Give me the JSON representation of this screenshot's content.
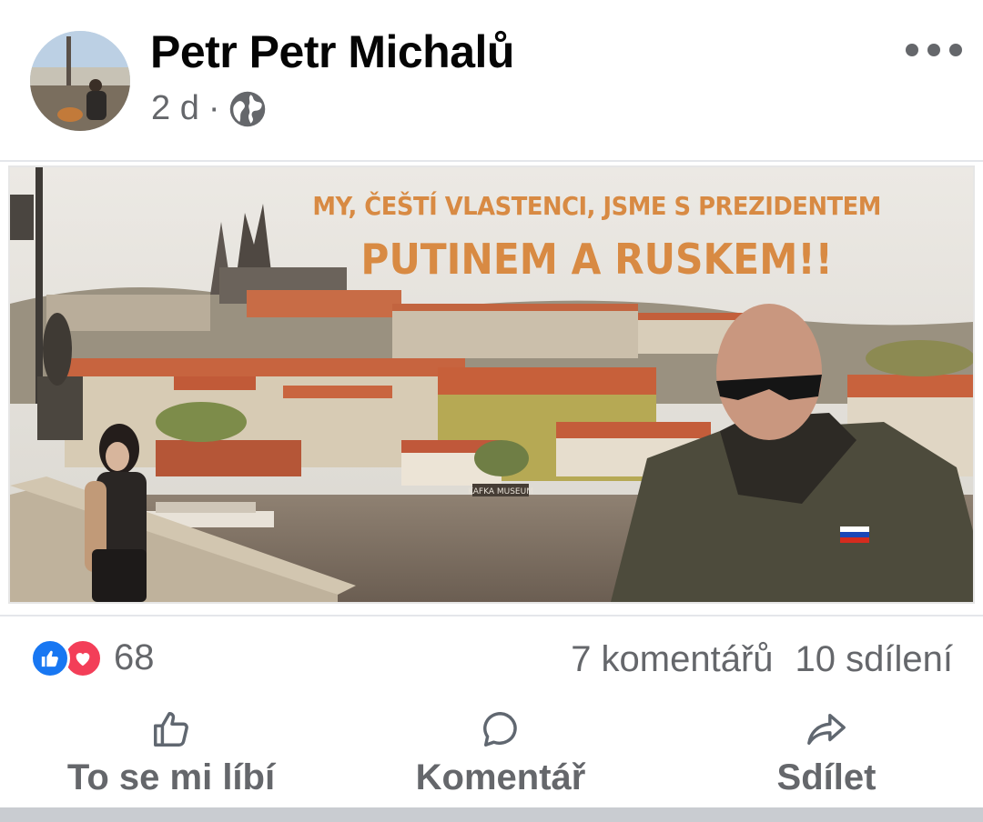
{
  "post": {
    "author": "Petr Petr Michalů",
    "time": "2 d",
    "separator": "·",
    "privacy_icon": "globe-icon",
    "more_icon": "more-options-icon"
  },
  "image": {
    "caption_line1": "MY, ČEŠTÍ VLASTENCI, JSME S PREZIDENTEM",
    "caption_line2": "PUTINEM A RUSKEM!!",
    "sign_text": "KAFKA MUSEUM"
  },
  "stats": {
    "reaction_icons": [
      "like-icon",
      "love-icon"
    ],
    "reaction_count": "68",
    "comments": "7 komentářů",
    "shares": "10 sdílení"
  },
  "actions": {
    "like": "To se mi líbí",
    "comment": "Komentář",
    "share": "Sdílet"
  },
  "colors": {
    "like_blue": "#1877f2",
    "love_red": "#f33e58",
    "caption_orange": "#d88a43",
    "secondary_text": "#65676b"
  }
}
